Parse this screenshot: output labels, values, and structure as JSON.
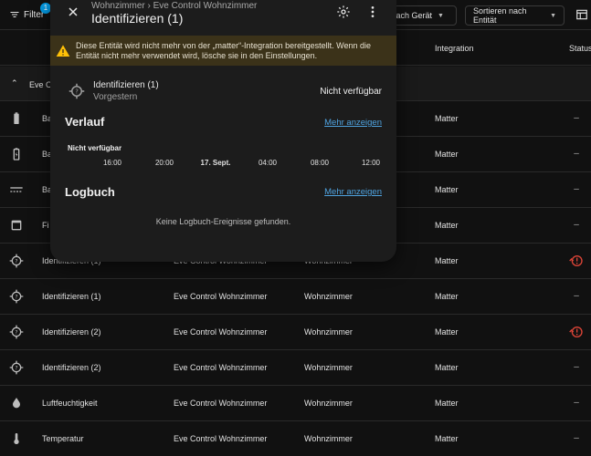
{
  "toolbar": {
    "filter_label": "Filter",
    "filter_badge": "1",
    "group_by_label": "n nach Gerät",
    "sort_label": "Sortieren nach Entität"
  },
  "columns": {
    "integration": "Integration",
    "status": "Status"
  },
  "group": {
    "label": "Eve Co"
  },
  "rows": [
    {
      "icon": "battery-icon",
      "name": "Ba",
      "device": "",
      "area": "",
      "integration": "Matter",
      "status": "–"
    },
    {
      "icon": "battery-charging-icon",
      "name": "Ba",
      "device": "",
      "area": "",
      "integration": "Matter",
      "status": "–"
    },
    {
      "icon": "current-dc-icon",
      "name": "Ba",
      "device": "",
      "area": "",
      "integration": "Matter",
      "status": "–"
    },
    {
      "icon": "firmware-icon",
      "name": "Fi",
      "device": "",
      "area": "",
      "integration": "Matter",
      "status": "–"
    },
    {
      "icon": "crosshairs-question-icon",
      "name": "Identifizieren (1)",
      "device": "Eve Control Wohnzimmer",
      "area": "Wohnzimmer",
      "integration": "Matter",
      "status": "restore-alert"
    },
    {
      "icon": "crosshairs-question-icon",
      "name": "Identifizieren (1)",
      "device": "Eve Control Wohnzimmer",
      "area": "Wohnzimmer",
      "integration": "Matter",
      "status": "–"
    },
    {
      "icon": "crosshairs-question-icon",
      "name": "Identifizieren (2)",
      "device": "Eve Control Wohnzimmer",
      "area": "Wohnzimmer",
      "integration": "Matter",
      "status": "restore-alert"
    },
    {
      "icon": "crosshairs-question-icon",
      "name": "Identifizieren (2)",
      "device": "Eve Control Wohnzimmer",
      "area": "Wohnzimmer",
      "integration": "Matter",
      "status": "–"
    },
    {
      "icon": "water-percent-icon",
      "name": "Luftfeuchtigkeit",
      "device": "Eve Control Wohnzimmer",
      "area": "Wohnzimmer",
      "integration": "Matter",
      "status": "–"
    },
    {
      "icon": "thermometer-icon",
      "name": "Temperatur",
      "device": "Eve Control Wohnzimmer",
      "area": "Wohnzimmer",
      "integration": "Matter",
      "status": "–"
    }
  ],
  "dialog": {
    "breadcrumb_area": "Wohnzimmer",
    "breadcrumb_sep": "›",
    "breadcrumb_device": "Eve Control Wohnzimmer",
    "title": "Identifizieren (1)",
    "warning": "Diese Entität wird nicht mehr von der „matter“-Integration bereitgestellt. Wenn die Entität nicht mehr verwendet wird, lösche sie in den Einstellungen.",
    "entity_name": "Identifizieren (1)",
    "entity_time": "Vorgestern",
    "entity_state": "Nicht verfügbar",
    "history_title": "Verlauf",
    "history_more": "Mehr anzeigen",
    "history_state_label": "Nicht verfügbar",
    "history_ticks": [
      "16:00",
      "20:00",
      "17. Sept.",
      "04:00",
      "08:00",
      "12:00"
    ],
    "logbook_title": "Logbuch",
    "logbook_more": "Mehr anzeigen",
    "logbook_empty": "Keine Logbuch-Ereignisse gefunden."
  },
  "colors": {
    "accent": "#039be5",
    "link": "#4fa3e0",
    "warning": "#ffc107",
    "error": "#db4437"
  }
}
